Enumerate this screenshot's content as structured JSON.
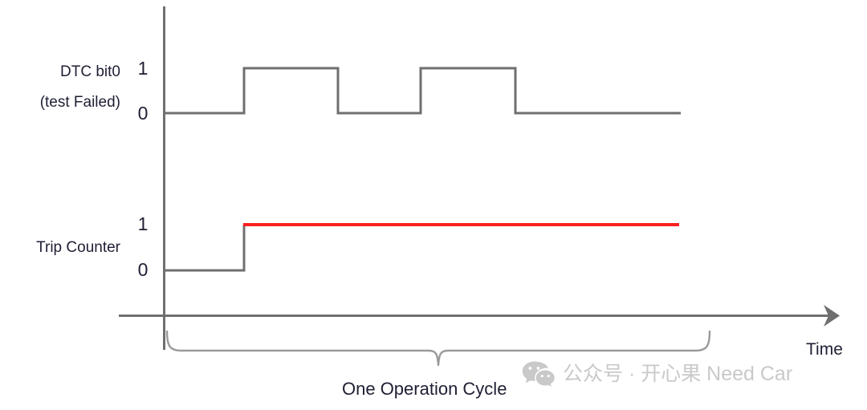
{
  "chart_data": {
    "type": "line",
    "title": "",
    "xlabel": "Time",
    "ylabel": "",
    "grid": false,
    "legend": "none",
    "axis": {
      "x_axis_label": "Time",
      "x_arrow": true,
      "y_tick_labels": [
        "0",
        "1"
      ],
      "x_range_note": "qualitative time axis, no numeric ticks"
    },
    "series": [
      {
        "name": "DTC bit0 (test Failed)",
        "type": "digital-step",
        "color": "#6f6f6f",
        "levels": [
          "0",
          "1"
        ],
        "points": [
          {
            "t": 0.0,
            "value": 0
          },
          {
            "t": 0.155,
            "value": 0
          },
          {
            "t": 0.155,
            "value": 1
          },
          {
            "t": 0.337,
            "value": 1
          },
          {
            "t": 0.337,
            "value": 0
          },
          {
            "t": 0.497,
            "value": 0
          },
          {
            "t": 0.497,
            "value": 1
          },
          {
            "t": 0.68,
            "value": 1
          },
          {
            "t": 0.68,
            "value": 0
          },
          {
            "t": 1.0,
            "value": 0
          }
        ],
        "pulse_count": 2
      },
      {
        "name": "Trip Counter",
        "type": "digital-step",
        "color": "#fb2020",
        "levels": [
          "0",
          "1"
        ],
        "points": [
          {
            "t": 0.0,
            "value": 0
          },
          {
            "t": 0.155,
            "value": 0
          },
          {
            "t": 0.155,
            "value": 1
          },
          {
            "t": 1.0,
            "value": 1
          }
        ],
        "high_segment_color": "#fb2020",
        "low_segment_color": "#6f6f6f"
      }
    ],
    "annotations": [
      {
        "type": "brace",
        "label": "One Operation Cycle",
        "t_start": 0.0,
        "t_end": 1.06
      }
    ]
  },
  "signals": {
    "dtc": {
      "name_line1": "DTC bit0",
      "name_line2": "(test Failed)",
      "level_high": "1",
      "level_low": "0"
    },
    "trip": {
      "name": "Trip Counter",
      "level_high": "1",
      "level_low": "0"
    }
  },
  "axis": {
    "time_label": "Time"
  },
  "annotation": {
    "cycle_label": "One Operation Cycle"
  },
  "watermark": {
    "icon": "wechat-icon",
    "text": "公众号 · 开心果 Need Car",
    "color": "#c9c9c9"
  },
  "colors": {
    "line_gray": "#6f6f6f",
    "trip_red": "#fb2020",
    "bracket_gray": "#9a9a9a",
    "text_dark": "#1f1f35",
    "background": "#ffffff"
  }
}
